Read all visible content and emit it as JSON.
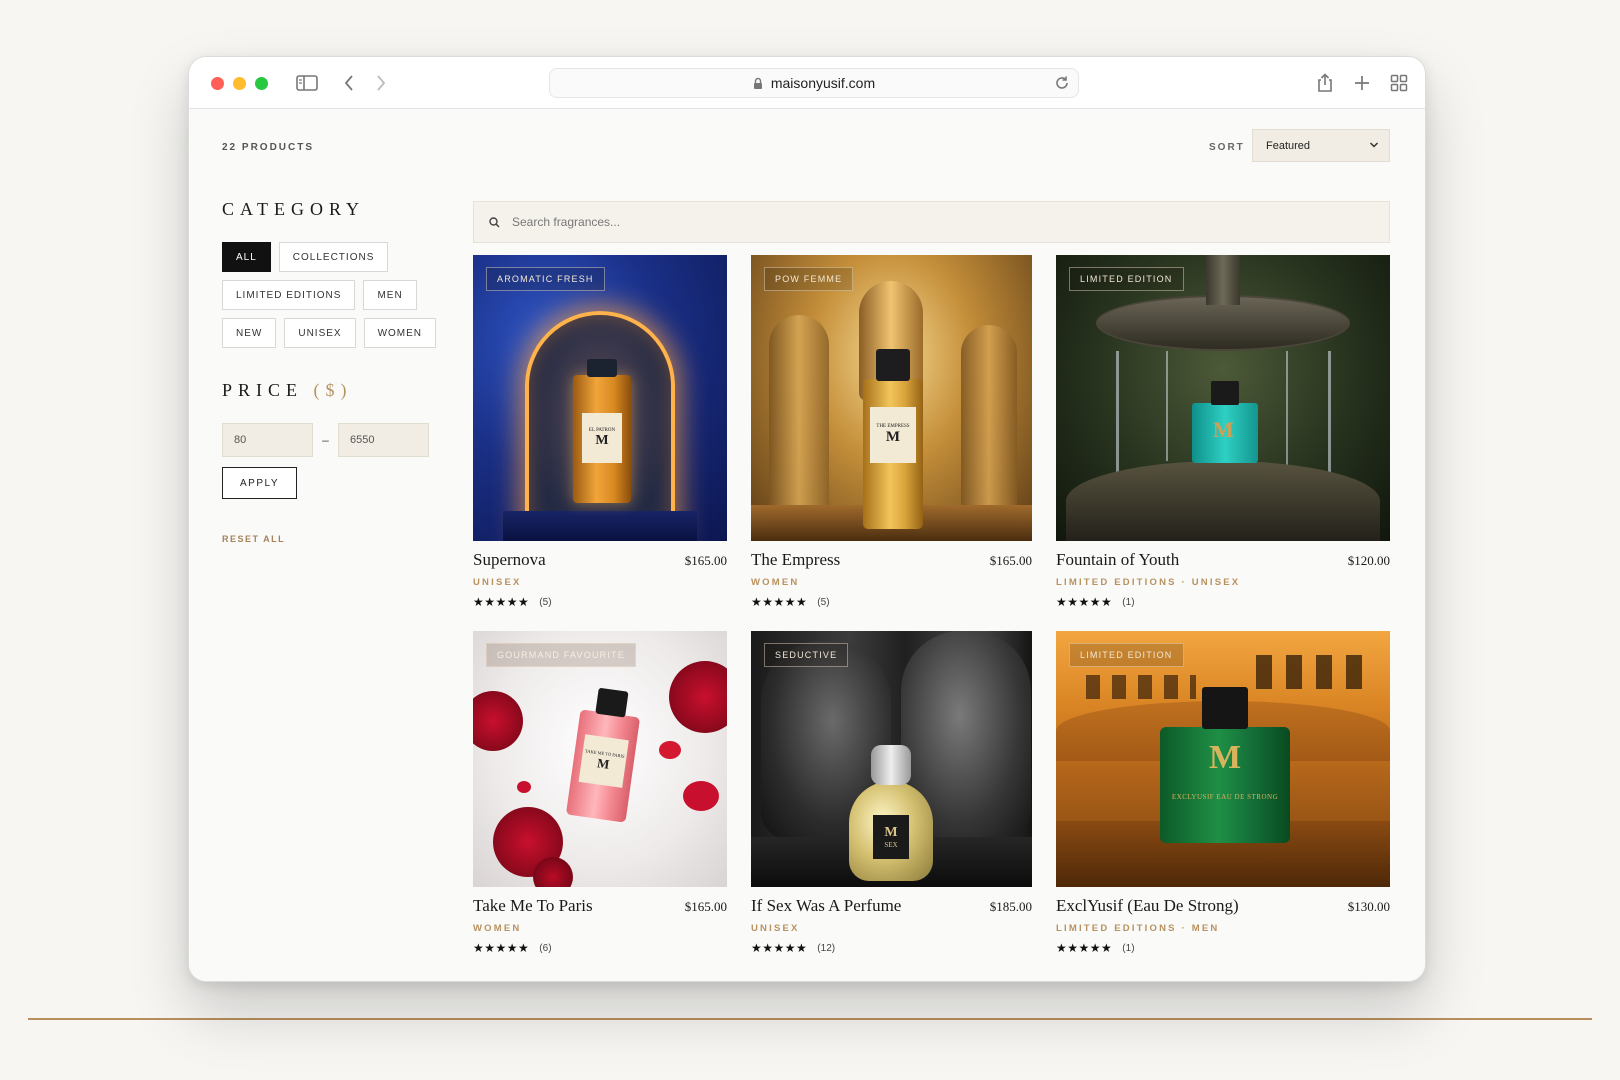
{
  "browser": {
    "url": "maisonyusif.com"
  },
  "listing": {
    "count_label": "22 PRODUCTS",
    "sort_label": "SORT",
    "sort_value": "Featured",
    "search_placeholder": "Search fragrances..."
  },
  "sidebar": {
    "category_heading": "CATEGORY",
    "categories": [
      {
        "label": "ALL",
        "active": true
      },
      {
        "label": "COLLECTIONS",
        "active": false
      },
      {
        "label": "LIMITED EDITIONS",
        "active": false
      },
      {
        "label": "MEN",
        "active": false
      },
      {
        "label": "NEW",
        "active": false
      },
      {
        "label": "UNISEX",
        "active": false
      },
      {
        "label": "WOMEN",
        "active": false
      }
    ],
    "price_heading": "PRICE",
    "price_unit": "($)",
    "price_min": "80",
    "price_max": "6550",
    "price_separator": "–",
    "apply_label": "APPLY",
    "reset_label": "RESET ALL"
  },
  "products": [
    {
      "tag": "AROMATIC FRESH",
      "name": "Supernova",
      "price": "$165.00",
      "category": "UNISEX",
      "stars": "★★★★★",
      "reviews": "(5)",
      "bottle_label": "EL PATRON"
    },
    {
      "tag": "POW FEMME",
      "name": "The Empress",
      "price": "$165.00",
      "category": "WOMEN",
      "stars": "★★★★★",
      "reviews": "(5)",
      "bottle_label": "THE EMPRESS"
    },
    {
      "tag": "LIMITED EDITION",
      "name": "Fountain of Youth",
      "price": "$120.00",
      "category": "LIMITED EDITIONS · UNISEX",
      "stars": "★★★★★",
      "reviews": "(1)",
      "bottle_label": ""
    },
    {
      "tag": "GOURMAND FAVOURITE",
      "name": "Take Me To Paris",
      "price": "$165.00",
      "category": "WOMEN",
      "stars": "★★★★★",
      "reviews": "(6)",
      "bottle_label": "TAKE ME TO PARIS"
    },
    {
      "tag": "SEDUCTIVE",
      "name": "If Sex Was A Perfume",
      "price": "$185.00",
      "category": "UNISEX",
      "stars": "★★★★★",
      "reviews": "(12)",
      "bottle_label": "SEX"
    },
    {
      "tag": "LIMITED EDITION",
      "name": "ExclYusif (Eau De Strong)",
      "price": "$130.00",
      "category": "LIMITED EDITIONS · MEN",
      "stars": "★★★★★",
      "reviews": "(1)",
      "bottle_label": "EXCLYUSIF EAU DE STRONG"
    }
  ],
  "colors": {
    "accent": "#b8925f",
    "chip_active": "#111111"
  }
}
